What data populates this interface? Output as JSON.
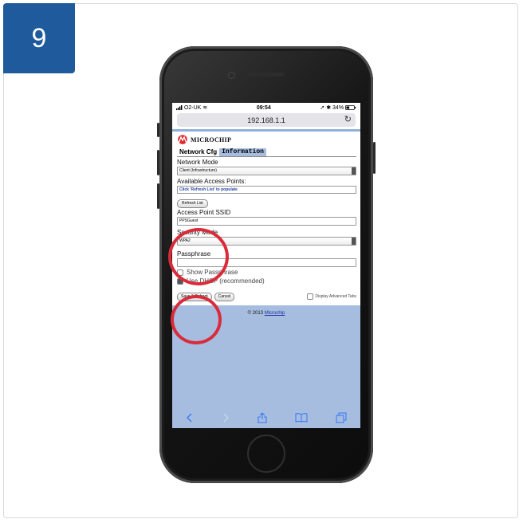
{
  "step": {
    "number": "9"
  },
  "status_bar": {
    "carrier": "O2-UK",
    "time": "09:54",
    "battery": "34%"
  },
  "browser": {
    "url": "192.168.1.1"
  },
  "page": {
    "brand": "MICROCHIP",
    "tabs": [
      "Network Cfg",
      "Information"
    ],
    "network_mode_label": "Network Mode",
    "network_mode_value": "Client (Infrastructure)",
    "ap_label": "Available Access Points:",
    "ap_hint": "Click 'Refresh List' to populate",
    "refresh_button": "Refresh List",
    "ssid_label": "Access Point SSID",
    "ssid_value": "PPSGuest",
    "security_label": "Security Mode",
    "security_value": "WPA2",
    "passphrase_label": "Passphrase",
    "passphrase_value": "",
    "show_passphrase": "Show Passphrase",
    "use_dhcp": "Use DHCP (recommended)",
    "save_button": "Save & Reboot",
    "cancel_button": "Cancel",
    "advanced_tabs": "Display Advanced Tabs",
    "copyright_prefix": "© 2013 ",
    "copyright_link": "Microchip"
  },
  "colors": {
    "badge": "#1e5a9c",
    "highlight": "#d92b3a",
    "page_blue": "#a6bde0"
  },
  "icons": [
    "back-icon",
    "forward-icon",
    "share-icon",
    "bookmarks-icon",
    "tabs-icon",
    "reload-icon",
    "wifi-icon",
    "bluetooth-icon",
    "battery-icon"
  ]
}
